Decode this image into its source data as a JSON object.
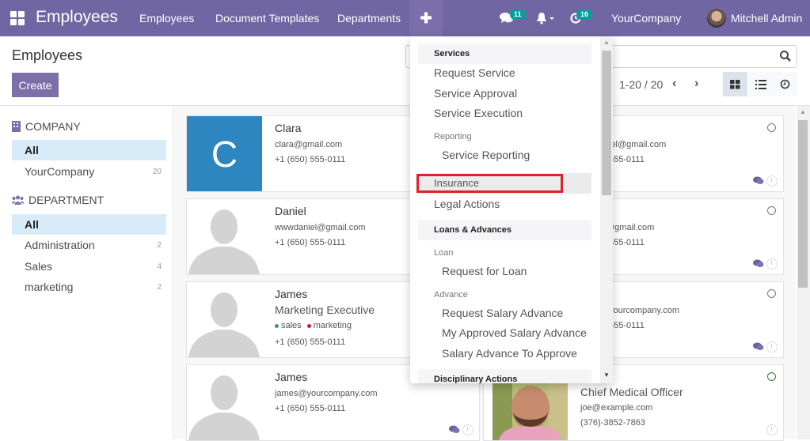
{
  "navbar": {
    "app_title": "Employees",
    "menus": [
      "Employees",
      "Document Templates",
      "Departments"
    ],
    "plus_label": "✚",
    "messages_badge": "11",
    "activities_badge": "16",
    "company": "YourCompany",
    "user": "Mitchell Admin"
  },
  "control_panel": {
    "title": "Employees",
    "create_label": "Create",
    "search_placeholder": "",
    "pager": "1-20 / 20",
    "prev": "‹",
    "next": "›",
    "views": [
      "kanban",
      "list",
      "activity"
    ],
    "active_view": "kanban"
  },
  "sidebar": {
    "company_header": "COMPANY",
    "company_items": [
      {
        "label": "All",
        "count": "",
        "active": true
      },
      {
        "label": "YourCompany",
        "count": "20",
        "active": false
      }
    ],
    "department_header": "DEPARTMENT",
    "department_items": [
      {
        "label": "All",
        "count": "",
        "active": true
      },
      {
        "label": "Administration",
        "count": "2",
        "active": false
      },
      {
        "label": "Sales",
        "count": "4",
        "active": false
      },
      {
        "label": "marketing",
        "count": "2",
        "active": false
      }
    ]
  },
  "cards": [
    {
      "name": "Clara",
      "email": "clara@gmail.com",
      "phone": "+1 (650) 555-0111",
      "initial": "C"
    },
    {
      "name": "Daniel",
      "email": "wwwdaniel@gmail.com",
      "phone": "+1 (650) 555-0111"
    },
    {
      "name": "James",
      "job": "Marketing Executive",
      "tags": [
        {
          "label": "sales",
          "color": "#3d8f9e"
        },
        {
          "label": "marketing",
          "color": "#d0105c"
        }
      ],
      "phone": "+1 (650) 555-0111"
    },
    {
      "name": "James",
      "email": "james@yourcompany.com",
      "phone": "+1 (650) 555-0111"
    },
    {
      "email_partial": "iel@gmail.com",
      "phone_partial": "555-0111"
    },
    {
      "email_partial": "@gmail.com",
      "phone_partial": "555-0111"
    },
    {
      "email_partial": "yourcompany.com",
      "phone_partial": "555-0111"
    },
    {
      "job": "Chief Medical Officer",
      "email": "joe@example.com",
      "phone": "(376)-3852-7863"
    }
  ],
  "dropdown": {
    "sections": {
      "services": "Services",
      "request_service": "Request Service",
      "service_approval": "Service Approval",
      "service_execution": "Service Execution",
      "reporting": "Reporting",
      "service_reporting": "Service Reporting",
      "insurance": "Insurance",
      "legal_actions": "Legal Actions",
      "loans_advances": "Loans & Advances",
      "loan": "Loan",
      "request_for_loan": "Request for Loan",
      "advance": "Advance",
      "request_salary_advance": "Request Salary Advance",
      "my_approved_salary_advance": "My Approved Salary Advance",
      "salary_advance_to_approve": "Salary Advance To Approve",
      "disciplinary_actions": "Disciplinary Actions"
    },
    "highlighted_item": "Insurance"
  },
  "colors": {
    "brand": "#7166a4",
    "badge": "#00a09d",
    "highlight_box": "#e0202a",
    "active_filter": "#d7ebf8"
  }
}
